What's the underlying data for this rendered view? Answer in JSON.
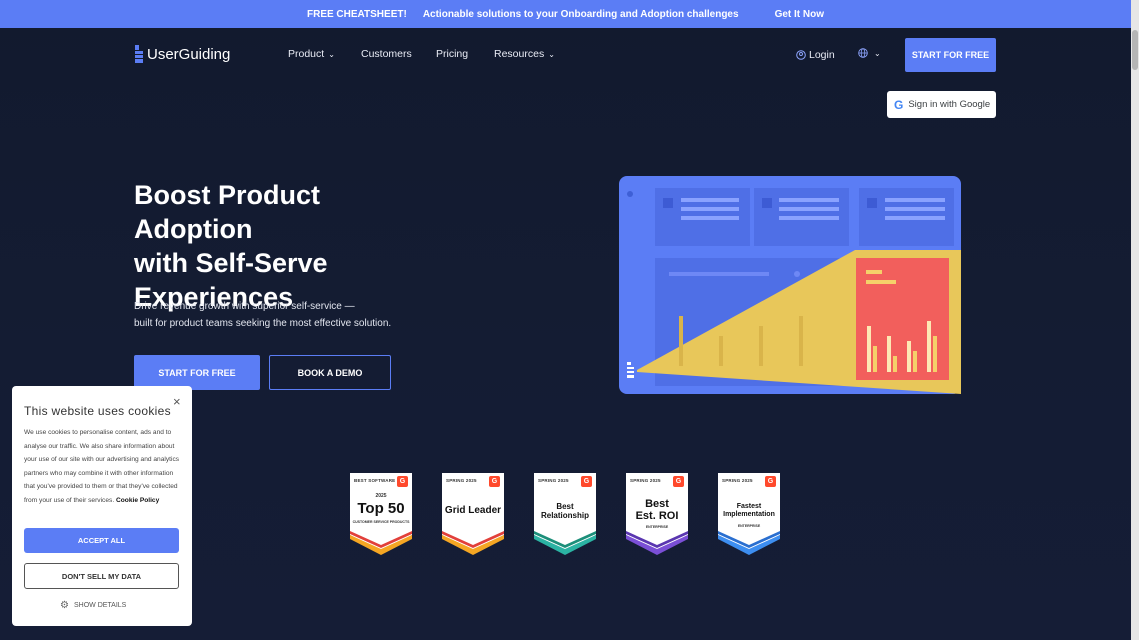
{
  "banner": {
    "label": "FREE CHEATSHEET!",
    "text": "Actionable solutions to your Onboarding and Adoption challenges",
    "cta": "Get It Now"
  },
  "nav": {
    "logo": "UserGuiding",
    "product": "Product",
    "customers": "Customers",
    "pricing": "Pricing",
    "resources": "Resources",
    "login": "Login",
    "start": "START FOR FREE",
    "google": "Sign in with Google",
    "google_g": "G"
  },
  "hero": {
    "title_line1": "Boost Product Adoption",
    "title_line2": "with Self-Serve",
    "title_line3": "Experiences",
    "sub_line1": "Drive revenue growth with superior self-service —",
    "sub_line2": "built for product teams seeking the most effective solution.",
    "cta_primary": "START FOR FREE",
    "cta_secondary": "BOOK A DEMO"
  },
  "badges": [
    {
      "top": "BEST SOFTWARE",
      "year": "2025",
      "main": "Top 50",
      "sub": "CUSTOMER SERVICE PRODUCTS",
      "color": "#f5a623"
    },
    {
      "top": "SPRING 2025",
      "main": "Grid Leader",
      "sub": "",
      "color": "#f5a623"
    },
    {
      "top": "SPRING 2025",
      "main": "Best Relationship",
      "sub": "",
      "color": "#2bb3a3"
    },
    {
      "top": "SPRING 2025",
      "main": "Best Est. ROI",
      "sub": "ENTERPRISE",
      "color": "#7b4fd6"
    },
    {
      "top": "SPRING 2025",
      "main": "Fastest Implementation",
      "sub": "ENTERPRISE",
      "color": "#3d8ef0"
    }
  ],
  "cookie": {
    "title": "This website uses cookies",
    "close": "×",
    "body": "We use cookies to personalise content, ads and to analyse our traffic. We also share information about your use of our site with our advertising and analytics partners who may combine it with other information that you've provided to them or that they've collected from your use of their services.",
    "policy": "Cookie Policy",
    "accept": "ACCEPT ALL",
    "dont_sell": "DON'T SELL MY DATA",
    "details": "SHOW DETAILS"
  },
  "colors": {
    "accent": "#5b7df5",
    "background": "#131b30"
  }
}
